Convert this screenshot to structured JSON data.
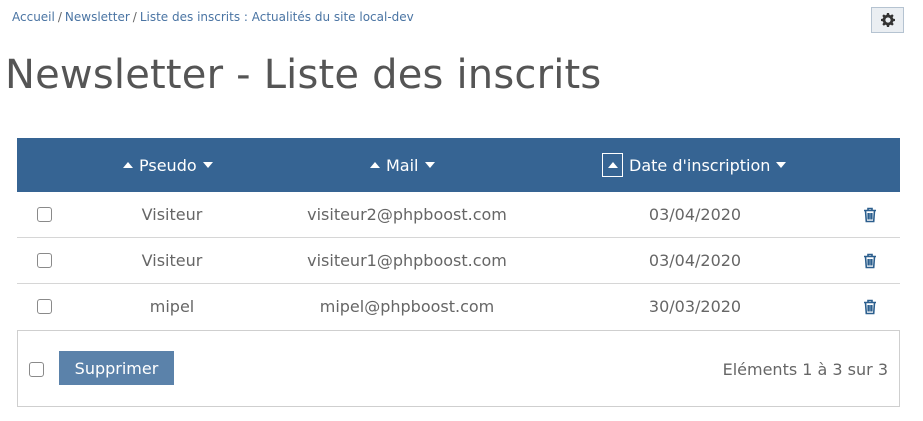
{
  "breadcrumb": {
    "items": [
      "Accueil",
      "Newsletter",
      "Liste des inscrits : Actualités du site local-dev"
    ],
    "separator": "/"
  },
  "page_title": "Newsletter - Liste des inscrits",
  "table": {
    "columns": {
      "pseudo": "Pseudo",
      "mail": "Mail",
      "date": "Date d'inscription"
    },
    "rows": [
      {
        "pseudo": "Visiteur",
        "mail": "visiteur2@phpboost.com",
        "date": "03/04/2020"
      },
      {
        "pseudo": "Visiteur",
        "mail": "visiteur1@phpboost.com",
        "date": "03/04/2020"
      },
      {
        "pseudo": "mipel",
        "mail": "mipel@phpboost.com",
        "date": "30/03/2020"
      }
    ]
  },
  "footer": {
    "delete_label": "Supprimer",
    "elements_text": "Eléments 1 à 3 sur 3"
  },
  "colors": {
    "header_bg": "#366493",
    "link": "#4a74a3",
    "button_bg": "#5b82aa",
    "trash_icon": "#2c5f8e"
  },
  "icons": [
    "gear-icon",
    "sort-asc-icon",
    "sort-desc-icon",
    "trash-icon"
  ]
}
